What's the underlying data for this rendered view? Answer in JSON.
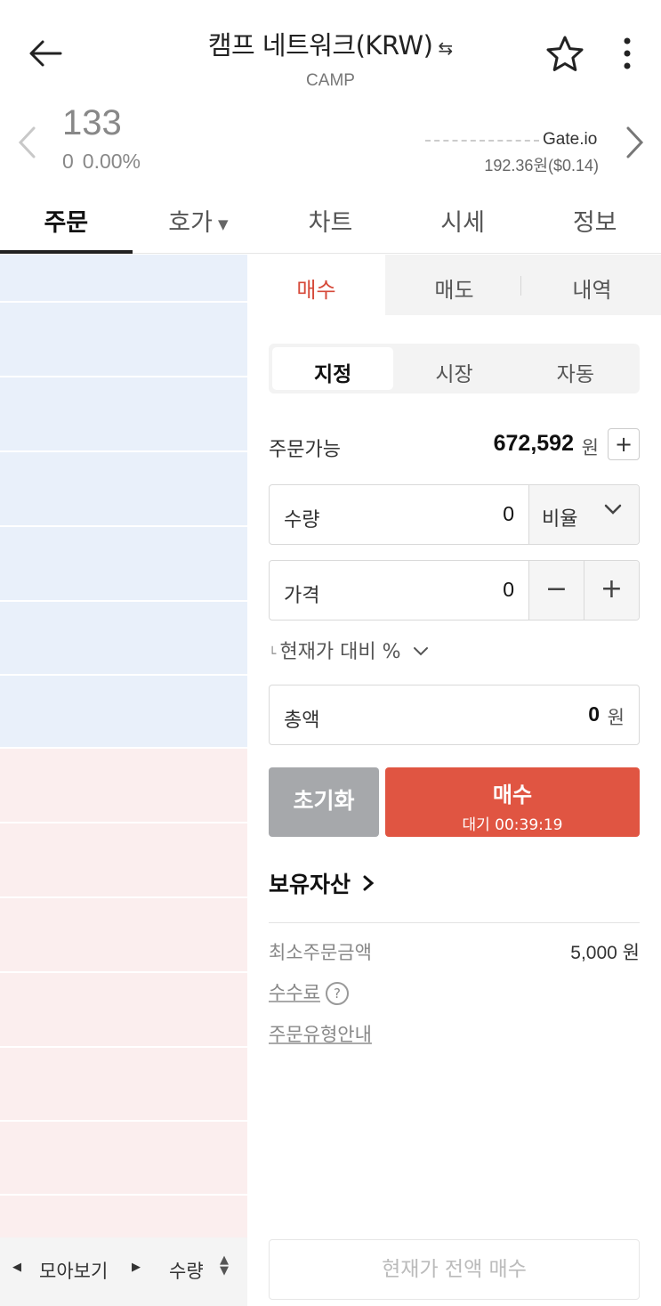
{
  "header": {
    "title": "캠프 네트워크(KRW)",
    "swap_icon": "⇆",
    "subtitle": "CAMP"
  },
  "price": {
    "current": "133",
    "change_amount": "0",
    "change_rate": "0.00%",
    "exchange_name": "Gate.io",
    "exchange_price": "192.36원($0.14)"
  },
  "tabs": [
    {
      "label": "주문"
    },
    {
      "label": "호가"
    },
    {
      "label": "차트"
    },
    {
      "label": "시세"
    },
    {
      "label": "정보"
    }
  ],
  "orderbook": {
    "ask_rows": 7,
    "bid_rows": 7,
    "footer": {
      "group_label": "모아보기",
      "qty_label": "수량"
    }
  },
  "order": {
    "side_tabs": [
      "매수",
      "매도",
      "내역"
    ],
    "type_tabs": [
      "지정",
      "시장",
      "자동"
    ],
    "available_label": "주문가능",
    "available_value": "672,592",
    "available_unit": "원",
    "qty_label": "수량",
    "qty_value": "0",
    "ratio_label": "비율",
    "price_label": "가격",
    "price_value": "0",
    "compare_label": "현재가 대비 %",
    "total_label": "총액",
    "total_value": "0",
    "total_unit": "원",
    "reset_label": "초기화",
    "buy_label": "매수",
    "buy_wait": "대기 00:39:19",
    "assets_label": "보유자산",
    "min_order_label": "최소주문금액",
    "min_order_value": "5,000 원",
    "fee_label": "수수료",
    "guide_label": "주문유형안내",
    "all_buy_label": "현재가 전액 매수"
  },
  "colors": {
    "buy_red": "#e05542",
    "ask_bg": "#e9f0fa",
    "bid_bg": "#fbeeee",
    "reset_gray": "#a6a8ab"
  }
}
